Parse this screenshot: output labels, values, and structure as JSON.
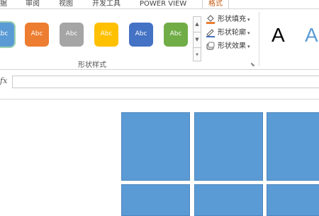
{
  "tabs": [
    "据",
    "审阅",
    "视图",
    "开发工具",
    "POWER VIEW",
    "格式"
  ],
  "active_tab": "格式",
  "shape_styles": {
    "button_label": "Abc",
    "buttons": [
      {
        "color": "#5b9bd5",
        "text_color": "#ffffff"
      },
      {
        "color": "#ed7d31",
        "text_color": "#ffffff"
      },
      {
        "color": "#a5a5a5",
        "text_color": "#ffffff"
      },
      {
        "color": "#ffc000",
        "text_color": "#ffffff"
      },
      {
        "color": "#4472c4",
        "text_color": "#ffffff"
      },
      {
        "color": "#70ad47",
        "text_color": "#ffffff"
      }
    ],
    "group_label": "形状样式"
  },
  "commands": {
    "fill": "形状填充",
    "outline": "形状轮廓",
    "effects": "形状效果"
  },
  "wordart": {
    "sample_black": "A",
    "sample_blue": "A"
  },
  "formula_bar": {
    "fx_label": "fx",
    "value": ""
  },
  "colors": {
    "active_tab": "#c55a11",
    "tile_fill": "#5b9bd5"
  }
}
